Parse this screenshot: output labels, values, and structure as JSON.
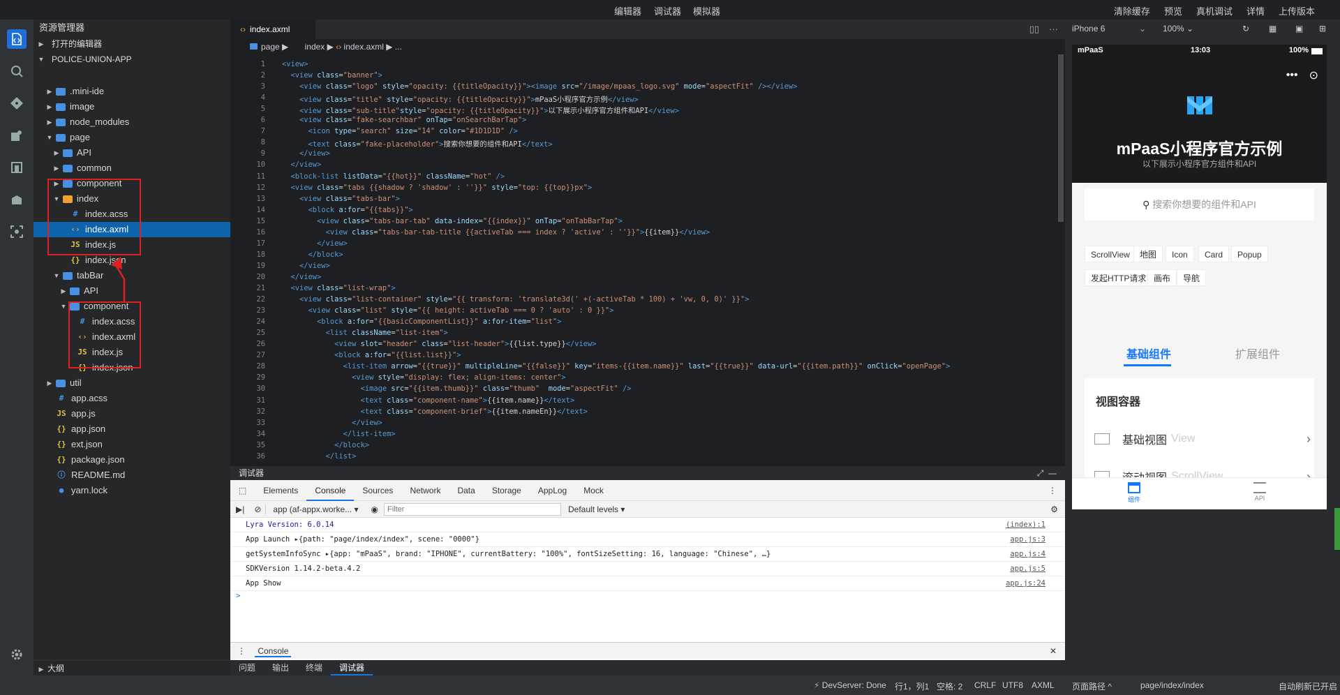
{
  "topbar": {
    "modes": [
      "编辑器",
      "调试器",
      "模拟器"
    ],
    "actions": [
      "清除缓存",
      "预览",
      "真机调试",
      "详情",
      "上传版本"
    ]
  },
  "explorer": {
    "title": "资源管理器",
    "open_editors": "打开的编辑器",
    "project": "POLICE-UNION-APP",
    "outline": "大纲",
    "tree": [
      {
        "label": ".mini-ide",
        "depth": 1,
        "kind": "folder",
        "open": false
      },
      {
        "label": "image",
        "depth": 1,
        "kind": "folder",
        "open": false
      },
      {
        "label": "node_modules",
        "depth": 1,
        "kind": "folder",
        "open": false
      },
      {
        "label": "page",
        "depth": 1,
        "kind": "folder",
        "open": true
      },
      {
        "label": "API",
        "depth": 2,
        "kind": "folder",
        "open": false
      },
      {
        "label": "common",
        "depth": 2,
        "kind": "folder",
        "open": false
      },
      {
        "label": "component",
        "depth": 2,
        "kind": "folder",
        "open": false
      },
      {
        "label": "index",
        "depth": 2,
        "kind": "folder",
        "open": true,
        "orange": true
      },
      {
        "label": "index.acss",
        "depth": 3,
        "kind": "acss"
      },
      {
        "label": "index.axml",
        "depth": 3,
        "kind": "axml",
        "selected": true
      },
      {
        "label": "index.js",
        "depth": 3,
        "kind": "js"
      },
      {
        "label": "index.json",
        "depth": 3,
        "kind": "json"
      },
      {
        "label": "tabBar",
        "depth": 2,
        "kind": "folder",
        "open": true
      },
      {
        "label": "API",
        "depth": 3,
        "kind": "folder",
        "open": false
      },
      {
        "label": "component",
        "depth": 3,
        "kind": "folder",
        "open": true
      },
      {
        "label": "index.acss",
        "depth": 4,
        "kind": "acss"
      },
      {
        "label": "index.axml",
        "depth": 4,
        "kind": "axml"
      },
      {
        "label": "index.js",
        "depth": 4,
        "kind": "js"
      },
      {
        "label": "index.json",
        "depth": 4,
        "kind": "json"
      },
      {
        "label": "util",
        "depth": 1,
        "kind": "folder",
        "open": false
      },
      {
        "label": "app.acss",
        "depth": 1,
        "kind": "acss"
      },
      {
        "label": "app.js",
        "depth": 1,
        "kind": "js"
      },
      {
        "label": "app.json",
        "depth": 1,
        "kind": "json"
      },
      {
        "label": "ext.json",
        "depth": 1,
        "kind": "json"
      },
      {
        "label": "package.json",
        "depth": 1,
        "kind": "json"
      },
      {
        "label": "README.md",
        "depth": 1,
        "kind": "md"
      },
      {
        "label": "yarn.lock",
        "depth": 1,
        "kind": "lock"
      }
    ]
  },
  "editor": {
    "tab": "index.axml",
    "breadcrumb": [
      "page",
      "index",
      "index.axml",
      "..."
    ],
    "lines": [
      "<view>",
      "  <view class=\"banner\">",
      "    <view class=\"logo\" style=\"opacity: {{titleOpacity}}\"><image src=\"/image/mpaas_logo.svg\" mode=\"aspectFit\" /></view>",
      "    <view class=\"title\" style=\"opacity: {{titleOpacity}}\">mPaaS小程序官方示例</view>",
      "    <view class=\"sub-title\"style=\"opacity: {{titleOpacity}}\">以下展示小程序官方组件和API</view>",
      "    <view class=\"fake-searchbar\" onTap=\"onSearchBarTap\">",
      "      <icon type=\"search\" size=\"14\" color=\"#1D1D1D\" />",
      "      <text class=\"fake-placeholder\">搜索你想要的组件和API</text>",
      "    </view>",
      "  </view>",
      "  <block-list listData=\"{{hot}}\" className=\"hot\" />",
      "  <view class=\"tabs {{shadow ? 'shadow' : ''}}\" style=\"top: {{top}}px\">",
      "    <view class=\"tabs-bar\">",
      "      <block a:for=\"{{tabs}}\">",
      "        <view class=\"tabs-bar-tab\" data-index=\"{{index}}\" onTap=\"onTabBarTap\">",
      "          <view class=\"tabs-bar-tab-title {{activeTab === index ? 'active' : ''}}\">{{item}}</view>",
      "        </view>",
      "      </block>",
      "    </view>",
      "  </view>",
      "  <view class=\"list-wrap\">",
      "    <view class=\"list-container\" style=\"{{ transform: 'translate3d(' +(-activeTab * 100) + 'vw, 0, 0)' }}\">",
      "      <view class=\"list\" style=\"{{ height: activeTab === 0 ? 'auto' : 0 }}\">",
      "        <block a:for=\"{{basicComponentList}}\" a:for-item=\"list\">",
      "          <list className=\"list-item\">",
      "            <view slot=\"header\" class=\"list-header\">{{list.type}}</view>",
      "            <block a:for=\"{{list.list}}\">",
      "              <list-item arrow=\"{{true}}\" multipleLine=\"{{false}}\" key=\"items-{{item.name}}\" last=\"{{true}}\" data-url=\"{{item.path}}\" onClick=\"openPage\">",
      "                <view style=\"display: flex; align-items: center\">",
      "                  <image src=\"{{item.thumb}}\" class=\"thumb\"  mode=\"aspectFit\" />",
      "                  <text class=\"component-name\">{{item.name}}</text>",
      "                  <text class=\"component-brief\">{{item.nameEn}}</text>",
      "                </view>",
      "              </list-item>",
      "            </block>",
      "          </list>"
    ]
  },
  "debugger": {
    "title": "调试器",
    "tabs": [
      "Elements",
      "Console",
      "Sources",
      "Network",
      "Data",
      "Storage",
      "AppLog",
      "Mock"
    ],
    "active_tab": "Console",
    "context": "app (af-appx.worke...",
    "filter_placeholder": "Filter",
    "levels": "Default levels",
    "logs": [
      {
        "text": "Lyra Version: 6.0.14",
        "src": "(index):1"
      },
      {
        "text": "App Launch ▸{path: \"page/index/index\", scene: \"0000\"}",
        "src": "app.js:3"
      },
      {
        "text": "getSystemInfoSync ▸{app: \"mPaaS\", brand: \"IPHONE\", currentBattery: \"100%\", fontSizeSetting: 16, language: \"Chinese\", …}",
        "src": "app.js:4"
      },
      {
        "text": "SDKVersion 1.14.2-beta.4.2",
        "src": "app.js:5"
      },
      {
        "text": "App Show",
        "src": "app.js:24"
      }
    ],
    "prompt": ">",
    "drawer": "Console"
  },
  "bottom_tabs": [
    "问题",
    "输出",
    "终端",
    "调试器"
  ],
  "bottom_active": "调试器",
  "status": {
    "server": "DevServer: Done",
    "pos": "行1，列1",
    "space": "空格: 2",
    "eol": "CRLF",
    "enc": "UTF8",
    "lang": "AXML",
    "path_label": "页面路径",
    "path": "page/index/index",
    "auto": "自动刷新已开启"
  },
  "simulator": {
    "device": "iPhone 6",
    "zoom": "100%",
    "phone": {
      "carrier": "mPaaS",
      "time": "13:03",
      "battery": "100%",
      "title": "mPaaS小程序官方示例",
      "subtitle": "以下展示小程序官方组件和API",
      "search": "搜索你想要的组件和API",
      "chips": [
        "ScrollView",
        "地图",
        "Icon",
        "Card",
        "Popup",
        "发起HTTP请求",
        "画布",
        "导航"
      ],
      "tabs": [
        "基础组件",
        "扩展组件"
      ],
      "section": "视图容器",
      "items": [
        {
          "name": "基础视图",
          "en": "View"
        },
        {
          "name": "滚动视图",
          "en": "ScrollView"
        }
      ],
      "bottom": [
        "组件",
        "API"
      ]
    }
  }
}
